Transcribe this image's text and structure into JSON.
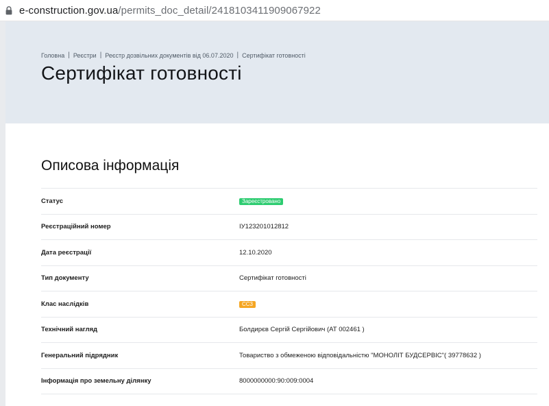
{
  "browser": {
    "url_host": "e-construction.gov.ua",
    "url_path": "/permits_doc_detail/2418103411909067922",
    "lock_icon": "lock-icon"
  },
  "breadcrumb": {
    "items": [
      "Головна",
      "Реєстри",
      "Реєстр дозвільних документів від 06.07.2020",
      "Сертифікат готовності"
    ]
  },
  "page": {
    "title": "Сертифікат готовності"
  },
  "section": {
    "title": "Описова інформація"
  },
  "info": {
    "rows": [
      {
        "label": "Статус",
        "value": "Зареєстровано"
      },
      {
        "label": "Реєстраційний номер",
        "value": "ІУ123201012812"
      },
      {
        "label": "Дата реєстрації",
        "value": "12.10.2020"
      },
      {
        "label": "Тип документу",
        "value": "Сертифікат готовності"
      },
      {
        "label": "Клас наслідків",
        "value": "СС3"
      },
      {
        "label": "Технічний нагляд",
        "value": "Болдирєв Сергій Сергійович (АТ 002461 )"
      },
      {
        "label": "Генеральний підрядник",
        "value": "Товариство з обмеженою відповідальністю \"МОНОЛІТ БУДСЕРВІС\"( 39778632 )"
      },
      {
        "label": "Інформація про земельну ділянку",
        "value": "8000000000:90:009:0004"
      }
    ]
  },
  "colors": {
    "status_badge": "#2ecc71",
    "class_badge": "#f5a623",
    "hero_background": "#e3e9f0"
  }
}
